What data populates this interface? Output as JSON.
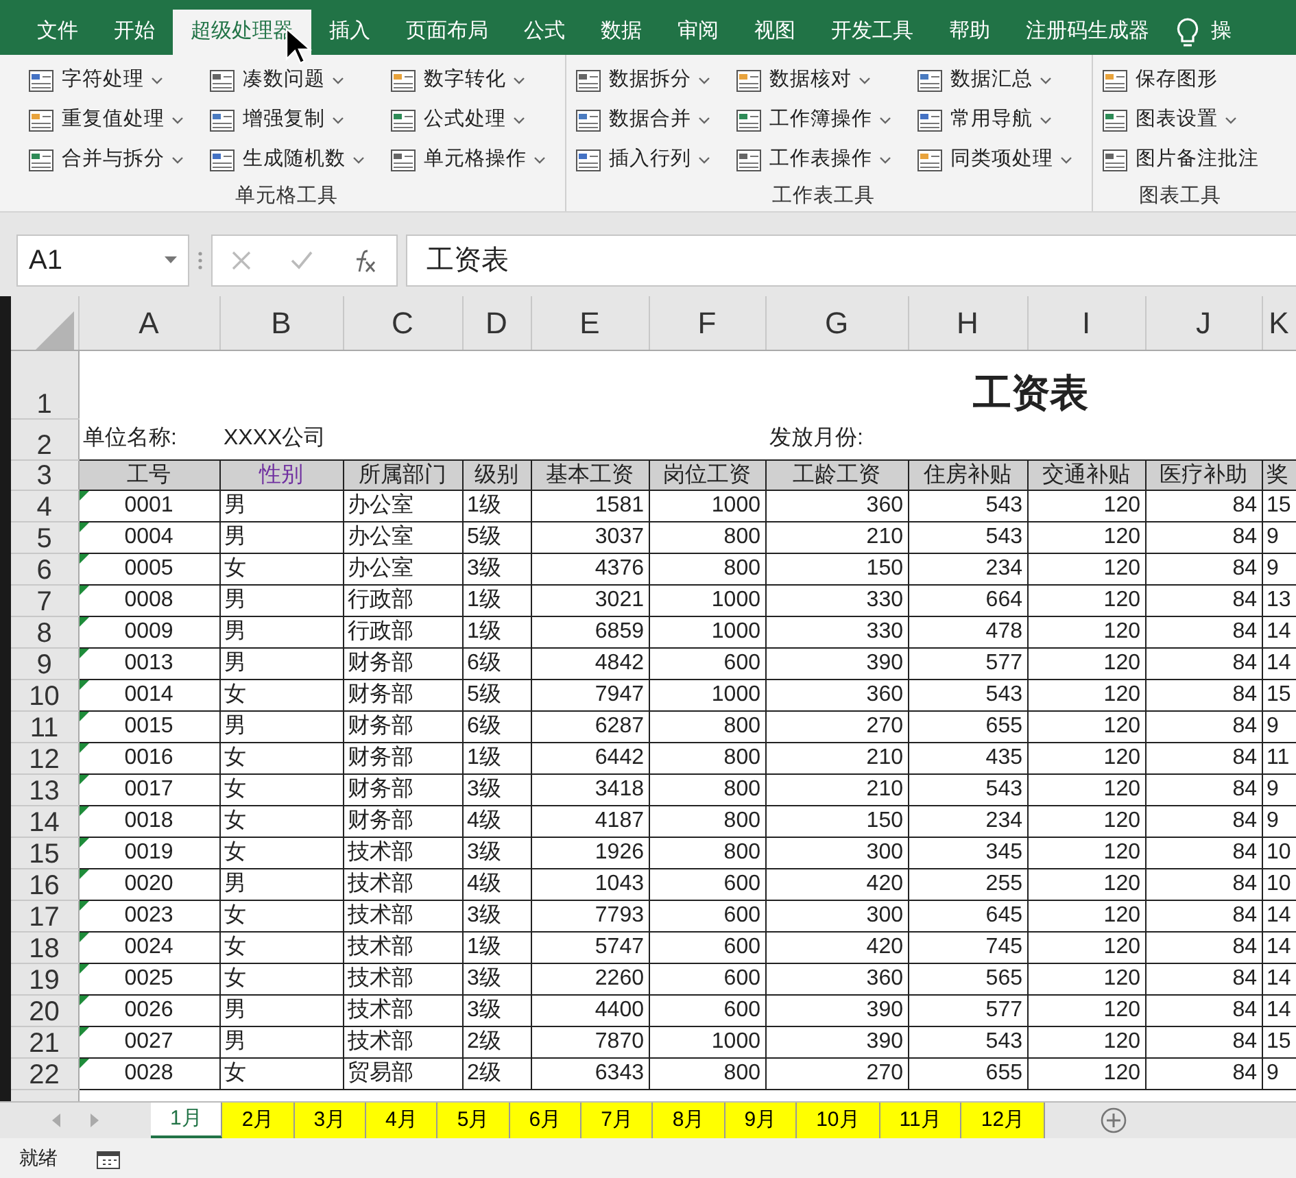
{
  "ribbon_tabs": [
    {
      "label": "文件",
      "selected": false
    },
    {
      "label": "开始",
      "selected": false
    },
    {
      "label": "超级处理器",
      "selected": true
    },
    {
      "label": "插入",
      "selected": false
    },
    {
      "label": "页面布局",
      "selected": false
    },
    {
      "label": "公式",
      "selected": false
    },
    {
      "label": "数据",
      "selected": false
    },
    {
      "label": "审阅",
      "selected": false
    },
    {
      "label": "视图",
      "selected": false
    },
    {
      "label": "开发工具",
      "selected": false
    },
    {
      "label": "帮助",
      "selected": false
    },
    {
      "label": "注册码生成器",
      "selected": false
    }
  ],
  "tell_me": "操",
  "ribbon_groups": [
    {
      "label": "单元格工具",
      "items": [
        {
          "label": "字符处理",
          "dropdown": true
        },
        {
          "label": "重复值处理",
          "dropdown": true
        },
        {
          "label": "合并与拆分",
          "dropdown": true
        },
        {
          "label": "凑数问题",
          "dropdown": true
        },
        {
          "label": "增强复制",
          "dropdown": true
        },
        {
          "label": "生成随机数",
          "dropdown": true
        },
        {
          "label": "数字转化",
          "dropdown": true
        },
        {
          "label": "公式处理",
          "dropdown": true
        },
        {
          "label": "单元格操作",
          "dropdown": true
        }
      ]
    },
    {
      "label": "工作表工具",
      "items": [
        {
          "label": "数据拆分",
          "dropdown": true
        },
        {
          "label": "数据合并",
          "dropdown": true
        },
        {
          "label": "插入行列",
          "dropdown": true
        },
        {
          "label": "数据核对",
          "dropdown": true
        },
        {
          "label": "工作簿操作",
          "dropdown": true
        },
        {
          "label": "工作表操作",
          "dropdown": true
        },
        {
          "label": "数据汇总",
          "dropdown": true
        },
        {
          "label": "常用导航",
          "dropdown": true
        },
        {
          "label": "同类项处理",
          "dropdown": true
        }
      ]
    },
    {
      "label": "图表工具",
      "items": [
        {
          "label": "保存图形",
          "dropdown": false
        },
        {
          "label": "图表设置",
          "dropdown": true
        },
        {
          "label": "图片备注批注",
          "dropdown": false
        }
      ]
    }
  ],
  "name_box": "A1",
  "formula": "工资表",
  "columns": [
    "A",
    "B",
    "C",
    "D",
    "E",
    "F",
    "G",
    "H",
    "I",
    "J",
    "K"
  ],
  "row_numbers": [
    "1",
    "2",
    "3",
    "4",
    "5",
    "6",
    "7",
    "8",
    "9",
    "10",
    "11",
    "12",
    "13",
    "14",
    "15",
    "16",
    "17",
    "18",
    "19",
    "20",
    "21",
    "22"
  ],
  "title": "工资表",
  "info_row": {
    "unit_label": "单位名称:",
    "unit_value": "XXXX公司",
    "month_label": "发放月份:"
  },
  "headers": [
    {
      "text": "工号"
    },
    {
      "text": "性别",
      "color": "#7030a0"
    },
    {
      "text": "所属部门"
    },
    {
      "text": "级别"
    },
    {
      "text": "基本工资"
    },
    {
      "text": "岗位工资"
    },
    {
      "text": "工龄工资"
    },
    {
      "text": "住房补贴"
    },
    {
      "text": "交通补贴"
    },
    {
      "text": "医疗补助"
    },
    {
      "text": "奖"
    }
  ],
  "rows": [
    {
      "flag": true,
      "cells": [
        "0001",
        "男",
        "办公室",
        "1级",
        "1581",
        "1000",
        "360",
        "543",
        "120",
        "84",
        "15"
      ]
    },
    {
      "flag": true,
      "cells": [
        "0004",
        "男",
        "办公室",
        "5级",
        "3037",
        "800",
        "210",
        "543",
        "120",
        "84",
        "9"
      ]
    },
    {
      "flag": true,
      "cells": [
        "0005",
        "女",
        "办公室",
        "3级",
        "4376",
        "800",
        "150",
        "234",
        "120",
        "84",
        "9"
      ]
    },
    {
      "flag": true,
      "cells": [
        "0008",
        "男",
        "行政部",
        "1级",
        "3021",
        "1000",
        "330",
        "664",
        "120",
        "84",
        "13"
      ]
    },
    {
      "flag": true,
      "cells": [
        "0009",
        "男",
        "行政部",
        "1级",
        "6859",
        "1000",
        "330",
        "478",
        "120",
        "84",
        "14"
      ]
    },
    {
      "flag": true,
      "cells": [
        "0013",
        "男",
        "财务部",
        "6级",
        "4842",
        "600",
        "390",
        "577",
        "120",
        "84",
        "14"
      ]
    },
    {
      "flag": true,
      "cells": [
        "0014",
        "女",
        "财务部",
        "5级",
        "7947",
        "1000",
        "360",
        "543",
        "120",
        "84",
        "15"
      ]
    },
    {
      "flag": true,
      "cells": [
        "0015",
        "男",
        "财务部",
        "6级",
        "6287",
        "800",
        "270",
        "655",
        "120",
        "84",
        "9"
      ]
    },
    {
      "flag": true,
      "cells": [
        "0016",
        "女",
        "财务部",
        "1级",
        "6442",
        "800",
        "210",
        "435",
        "120",
        "84",
        "11"
      ]
    },
    {
      "flag": true,
      "cells": [
        "0017",
        "女",
        "财务部",
        "3级",
        "3418",
        "800",
        "210",
        "543",
        "120",
        "84",
        "9"
      ]
    },
    {
      "flag": true,
      "cells": [
        "0018",
        "女",
        "财务部",
        "4级",
        "4187",
        "800",
        "150",
        "234",
        "120",
        "84",
        "9"
      ]
    },
    {
      "flag": true,
      "cells": [
        "0019",
        "女",
        "技术部",
        "3级",
        "1926",
        "800",
        "300",
        "345",
        "120",
        "84",
        "10"
      ]
    },
    {
      "flag": true,
      "cells": [
        "0020",
        "男",
        "技术部",
        "4级",
        "1043",
        "600",
        "420",
        "255",
        "120",
        "84",
        "10"
      ]
    },
    {
      "flag": true,
      "cells": [
        "0023",
        "女",
        "技术部",
        "3级",
        "7793",
        "600",
        "300",
        "645",
        "120",
        "84",
        "14"
      ]
    },
    {
      "flag": true,
      "cells": [
        "0024",
        "女",
        "技术部",
        "1级",
        "5747",
        "600",
        "420",
        "745",
        "120",
        "84",
        "14"
      ]
    },
    {
      "flag": true,
      "cells": [
        "0025",
        "女",
        "技术部",
        "3级",
        "2260",
        "600",
        "360",
        "565",
        "120",
        "84",
        "14"
      ]
    },
    {
      "flag": true,
      "cells": [
        "0026",
        "男",
        "技术部",
        "3级",
        "4400",
        "600",
        "390",
        "577",
        "120",
        "84",
        "14"
      ]
    },
    {
      "flag": true,
      "cells": [
        "0027",
        "男",
        "技术部",
        "2级",
        "7870",
        "1000",
        "390",
        "543",
        "120",
        "84",
        "15"
      ]
    },
    {
      "flag": true,
      "cells": [
        "0028",
        "女",
        "贸易部",
        "2级",
        "6343",
        "800",
        "270",
        "655",
        "120",
        "84",
        "9"
      ]
    }
  ],
  "sheet_tabs": [
    {
      "label": "1月",
      "selected": true
    },
    {
      "label": "2月",
      "selected": false,
      "color": "#ffff00"
    },
    {
      "label": "3月",
      "selected": false,
      "color": "#ffff00"
    },
    {
      "label": "4月",
      "selected": false,
      "color": "#ffff00"
    },
    {
      "label": "5月",
      "selected": false,
      "color": "#ffff00"
    },
    {
      "label": "6月",
      "selected": false,
      "color": "#ffff00"
    },
    {
      "label": "7月",
      "selected": false,
      "color": "#ffff00"
    },
    {
      "label": "8月",
      "selected": false,
      "color": "#ffff00"
    },
    {
      "label": "9月",
      "selected": false,
      "color": "#ffff00"
    },
    {
      "label": "10月",
      "selected": false,
      "color": "#ffff00"
    },
    {
      "label": "11月",
      "selected": false,
      "color": "#ffff00"
    },
    {
      "label": "12月",
      "selected": false,
      "color": "#ffff00"
    }
  ],
  "status": "就绪"
}
